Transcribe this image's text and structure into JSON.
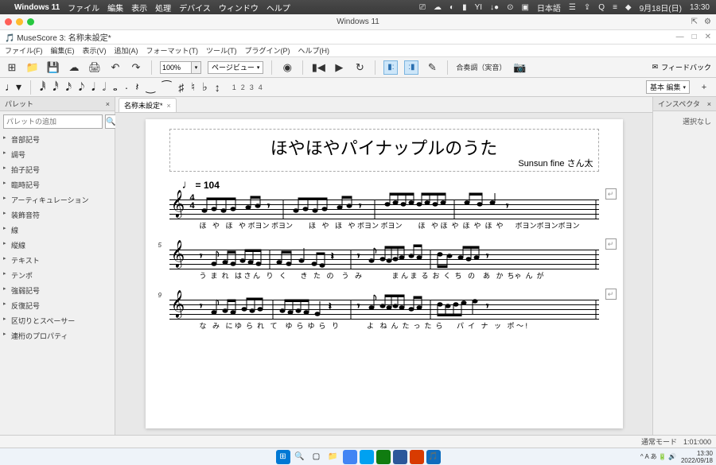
{
  "mac_menu": {
    "app": "Windows 11",
    "items": [
      "ファイル",
      "編集",
      "表示",
      "処理",
      "デバイス",
      "ウィンドウ",
      "ヘルプ"
    ],
    "right": [
      "⎚",
      "☁",
      "◐",
      "▮",
      "YI",
      "↓●",
      "⊙",
      "▣",
      "日本語",
      "☰",
      "⇪",
      "Q",
      "≡",
      "◆"
    ],
    "date": "9月18日(日)",
    "time": "13:30"
  },
  "win_title": "Windows 11",
  "muse": {
    "title": "MuseScore 3: 名称未設定*",
    "menu": [
      "ファイル(F)",
      "編集(E)",
      "表示(V)",
      "追加(A)",
      "フォーマット(T)",
      "ツール(T)",
      "プラグイン(P)",
      "ヘルプ(H)"
    ]
  },
  "toolbar": {
    "zoom": "100%",
    "pageview": "ページビュー",
    "concert": "合奏調（実音）",
    "feedback": "フィードバック"
  },
  "notebar": {
    "voices": [
      "1",
      "2",
      "3",
      "4"
    ],
    "ws_label": "基本 編集"
  },
  "palette": {
    "header": "パレット",
    "add_ph": "パレットの追加",
    "items": [
      "音部記号",
      "調号",
      "拍子記号",
      "臨時記号",
      "アーティキュレーション",
      "装飾音符",
      "線",
      "縦線",
      "テキスト",
      "テンポ",
      "強弱記号",
      "反復記号",
      "区切りとスペーサー",
      "連桁のプロパティ"
    ]
  },
  "tab": {
    "label": "名称未設定*"
  },
  "score": {
    "title": "ほやほやパイナップルのうた",
    "composer": "Sunsun fine さん太",
    "tempo_note": "♩",
    "tempo_eq": "= 104",
    "ts_top": "4",
    "ts_bot": "4",
    "systems": [
      {
        "measure": "",
        "lyrics": "ほ   や   ほ   や ボヨン ボヨン        ほ   や   ほ   や ボヨン ボヨン        ほ   や ほ  や  ほ  や  ほ  や      ボヨンボヨンボヨン"
      },
      {
        "measure": "5",
        "lyrics": "う  ま  れ   は さ ん   り   く       き   た   の    う   み               ま ん ま  る  お  く  ち   の    あ   か  ちゃ  ん  が"
      },
      {
        "measure": "9",
        "lyrics": "な   み   に ゆ  ら  れ   て    ゆ  ら  ゆ  ら   り              よ   ね  ん  た  っ  た  ら       パ  イ   ナ   ッ   ポ ～ !"
      }
    ]
  },
  "inspector": {
    "header": "インスペクタ",
    "empty": "選択なし"
  },
  "status": {
    "mode": "通常モード",
    "pos": "1:01:000"
  },
  "taskbar": {
    "tray_icons": "^  A  あ  🔋  🔊",
    "time": "13:30",
    "date": "2022/09/18"
  }
}
